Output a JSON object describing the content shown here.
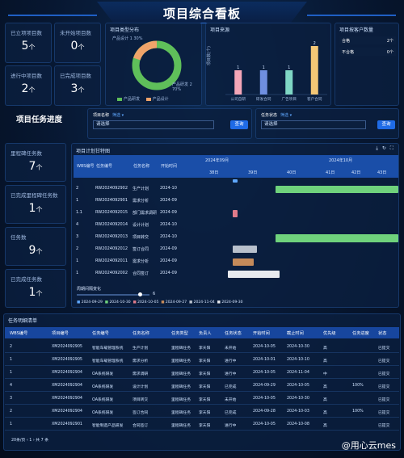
{
  "title": "项目综合看板",
  "stats": [
    {
      "label": "已立项项目数",
      "value": "5",
      "unit": "个"
    },
    {
      "label": "未开始项目数",
      "value": "0",
      "unit": "个"
    },
    {
      "label": "进行中项目数",
      "value": "2",
      "unit": "个"
    },
    {
      "label": "已完成项目数",
      "value": "3",
      "unit": "个"
    }
  ],
  "donut": {
    "title": "项目类型分布",
    "slices": [
      {
        "name": "产品研发",
        "value": 70,
        "pct": "70%",
        "color": "#5fbf5a"
      },
      {
        "name": "产品设计",
        "value": 30,
        "pct": "30%",
        "color": "#f0a46a"
      }
    ],
    "label_top": "产品设计 1",
    "label_top_pct": "30%",
    "label_bottom": "产品研发 2",
    "label_bottom_pct": "70%"
  },
  "bar_chart": {
    "title": "项目来源",
    "ylabel": "项目数(个)",
    "chart_data": {
      "type": "bar",
      "categories": [
        "公司自研",
        "研发合同",
        "广告项目",
        "客户合同"
      ],
      "values": [
        1,
        1,
        1,
        2
      ],
      "colors": [
        "#f4a6b8",
        "#6f8fe0",
        "#7fd6c4",
        "#f3c776"
      ],
      "ylim": [
        0,
        2
      ]
    }
  },
  "status_panel": {
    "title": "项目按客户数量",
    "rows": [
      {
        "name": "合格",
        "value": "2个"
      },
      {
        "name": "不合格",
        "value": "0个"
      }
    ]
  },
  "progress_title": "项目任务进度",
  "filter1": {
    "label": "项目名称",
    "tag": "筛选",
    "value": "请选择",
    "button": "查询"
  },
  "filter2": {
    "label": "任务状态",
    "tag": "筛选",
    "value": "请选择",
    "button": "查询"
  },
  "left_stats": [
    {
      "label": "里程碑任务数",
      "value": "7",
      "unit": "个"
    },
    {
      "label": "已完成里程碑任务数",
      "value": "1",
      "unit": "个"
    },
    {
      "label": "任务数",
      "value": "9",
      "unit": "个"
    },
    {
      "label": "已完成任务数",
      "value": "1",
      "unit": "个"
    }
  ],
  "gantt": {
    "title": "项目计划甘特图",
    "headers": [
      "WBS编号",
      "任务编号",
      "任务名称",
      "开始时间"
    ],
    "months": [
      "2024年09月",
      "2024年10月"
    ],
    "days": [
      "38日",
      "39日",
      "40日",
      "41日",
      "42日",
      "43日"
    ],
    "rows": [
      {
        "wbs": "2",
        "code": "RW2024092902",
        "name": "生产计划",
        "start": "2024-10"
      },
      {
        "wbs": "1",
        "code": "RW2024092901",
        "name": "需求分析",
        "start": "2024-09"
      },
      {
        "wbs": "1.1",
        "code": "RW2024092015",
        "name": "部门需求调研",
        "start": "2024-09"
      },
      {
        "wbs": "4",
        "code": "RW2024092014",
        "name": "设计计划",
        "start": "2024-10"
      },
      {
        "wbs": "3",
        "code": "RW2024092013",
        "name": "项目转交",
        "start": "2024-10"
      },
      {
        "wbs": "2",
        "code": "RW2024092012",
        "name": "签订合同",
        "start": "2024-09"
      },
      {
        "wbs": "1",
        "code": "RW2024092011",
        "name": "需求分析",
        "start": "2024-09"
      },
      {
        "wbs": "1",
        "code": "RW2024092002",
        "name": "合同签订",
        "start": "2024-09"
      }
    ],
    "zoom_label": "周期间隔变化",
    "zoom_value": "6",
    "legend": [
      "2024-09-29",
      "2024-10-30",
      "2024-10-05",
      "2024-09-27",
      "2024-11-04",
      "2024-09-30"
    ]
  },
  "table": {
    "title": "任务明细清单",
    "headers": [
      "WBS编号",
      "项目编号",
      "任务编号",
      "任务名称",
      "任务类型",
      "负责人",
      "任务状态",
      "开始时间",
      "截止时间",
      "优先级",
      "任务进度",
      "状态"
    ],
    "rows": [
      [
        "2",
        "XM2024092905",
        "智能车载管理系统",
        "生产计划",
        "里程碑任务",
        "李天阳",
        "未开始",
        "2024-10-05",
        "2024-10-30",
        "高",
        "",
        "已提交"
      ],
      [
        "1",
        "XM2024092905",
        "智能车载管理系统",
        "需求分析",
        "里程碑任务",
        "李天阳",
        "进行中",
        "2024-10-01",
        "2024-10-10",
        "高",
        "",
        "已提交"
      ],
      [
        "1",
        "XM2024092904",
        "OA系统研发",
        "需求调研",
        "里程碑任务",
        "李天阳",
        "进行中",
        "2024-10-05",
        "2024-11-04",
        "中",
        "",
        "已提交"
      ],
      [
        "4",
        "XM2024092904",
        "OA系统研发",
        "设计计划",
        "里程碑任务",
        "李天阳",
        "已完成",
        "2024-09-29",
        "2024-10-05",
        "高",
        "100%",
        "已提交"
      ],
      [
        "3",
        "XM2024092904",
        "OA系统研发",
        "项目转交",
        "里程碑任务",
        "李天阳",
        "未开始",
        "2024-10-05",
        "2024-10-30",
        "高",
        "",
        "已提交"
      ],
      [
        "2",
        "XM2024092904",
        "OA系统研发",
        "签订合同",
        "里程碑任务",
        "李天阳",
        "已完成",
        "2024-09-28",
        "2024-10-03",
        "高",
        "100%",
        "已提交"
      ],
      [
        "1",
        "XM2024092901",
        "智能制造产品研发",
        "合同签订",
        "里程碑任务",
        "李天阳",
        "进行中",
        "2024-10-05",
        "2024-10-08",
        "高",
        "",
        "已提交"
      ]
    ],
    "pagination": "20条/页  ‹  1  ›  共 7 条"
  },
  "watermark": "@用心云mes"
}
